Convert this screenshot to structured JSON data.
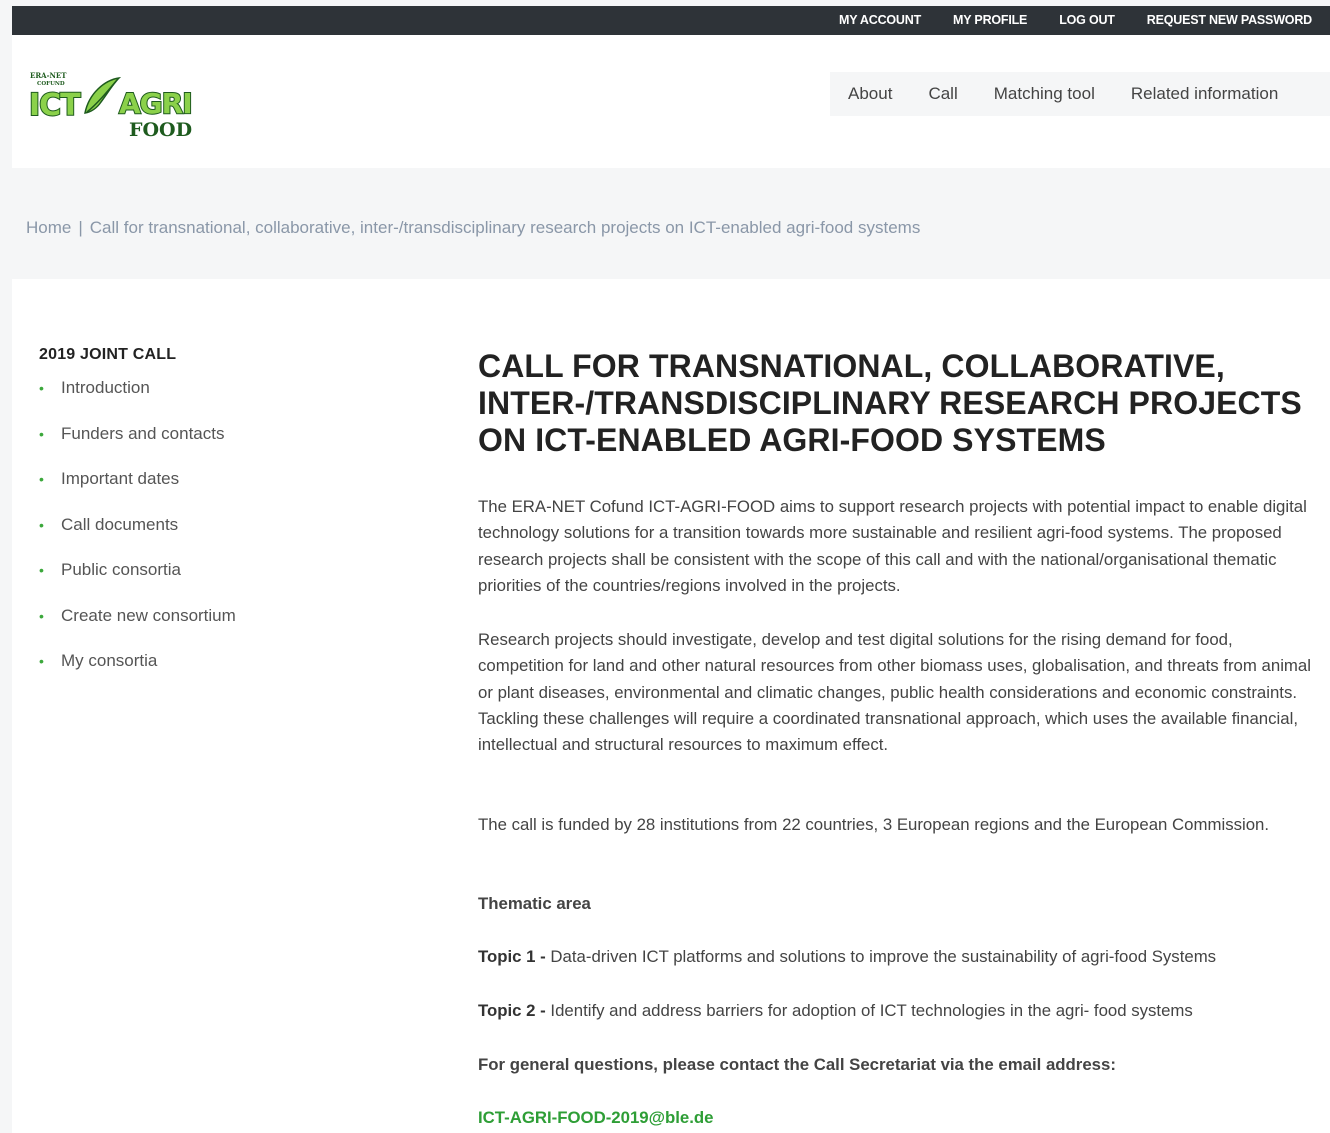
{
  "topbar": {
    "links": [
      "MY ACCOUNT",
      "MY PROFILE",
      "LOG OUT",
      "REQUEST NEW PASSWORD"
    ]
  },
  "logo": {
    "line1": "ERA-NET",
    "line2": "COFUND",
    "main": "ICT AGRI",
    "sub": "FOOD"
  },
  "nav": {
    "items": [
      "About",
      "Call",
      "Matching tool",
      "Related information"
    ]
  },
  "breadcrumb": {
    "home": "Home",
    "separator": "|",
    "current": "Call for transnational, collaborative, inter-/transdisciplinary research projects on ICT-enabled agri-food systems"
  },
  "sidebar": {
    "title": "2019 JOINT CALL",
    "items": [
      "Introduction",
      "Funders and contacts",
      "Important dates",
      "Call documents",
      "Public consortia",
      "Create new consortium",
      "My consortia"
    ]
  },
  "content": {
    "title": "CALL FOR TRANSNATIONAL, COLLABORATIVE, INTER-/TRANSDISCIPLINARY RESEARCH PROJECTS ON ICT-ENABLED AGRI-FOOD SYSTEMS",
    "p1": "The ERA-NET Cofund ICT-AGRI-FOOD aims to support research projects with potential impact to enable digital technology solutions for a transition towards more sustainable and resilient agri-food systems. The proposed research projects shall be consistent with the scope of this call and with the national/organisational thematic priorities of the countries/regions involved in the projects.",
    "p2": "Research projects should investigate, develop and test digital solutions for the rising demand for food, competition for land and other natural resources from other biomass uses, globalisation, and threats from animal or plant diseases, environmental and climatic changes, public health considerations and economic constraints. Tackling these challenges will require a coordinated transnational approach, which uses the available financial, intellectual and structural resources to maximum effect.",
    "p3": "The call is funded by 28 institutions from 22 countries, 3 European regions and the European Commission.",
    "thematic_heading": "Thematic area",
    "topic1_label": "Topic 1 -",
    "topic1_text": " Data-driven ICT platforms and solutions to improve the sustainability of agri-food Systems",
    "topic2_label": "Topic 2 -",
    "topic2_text": " Identify and address barriers for adoption of ICT technologies in the agri- food systems",
    "contact_text": "For general questions, please contact the Call Secretariat via the email address:",
    "email": "ICT-AGRI-FOOD-2019@ble.de"
  },
  "colors": {
    "topbar_bg": "#2e3338",
    "accent_green": "#2e9e36",
    "logo_green": "#7cc242",
    "logo_dark": "#1e5b1e"
  }
}
